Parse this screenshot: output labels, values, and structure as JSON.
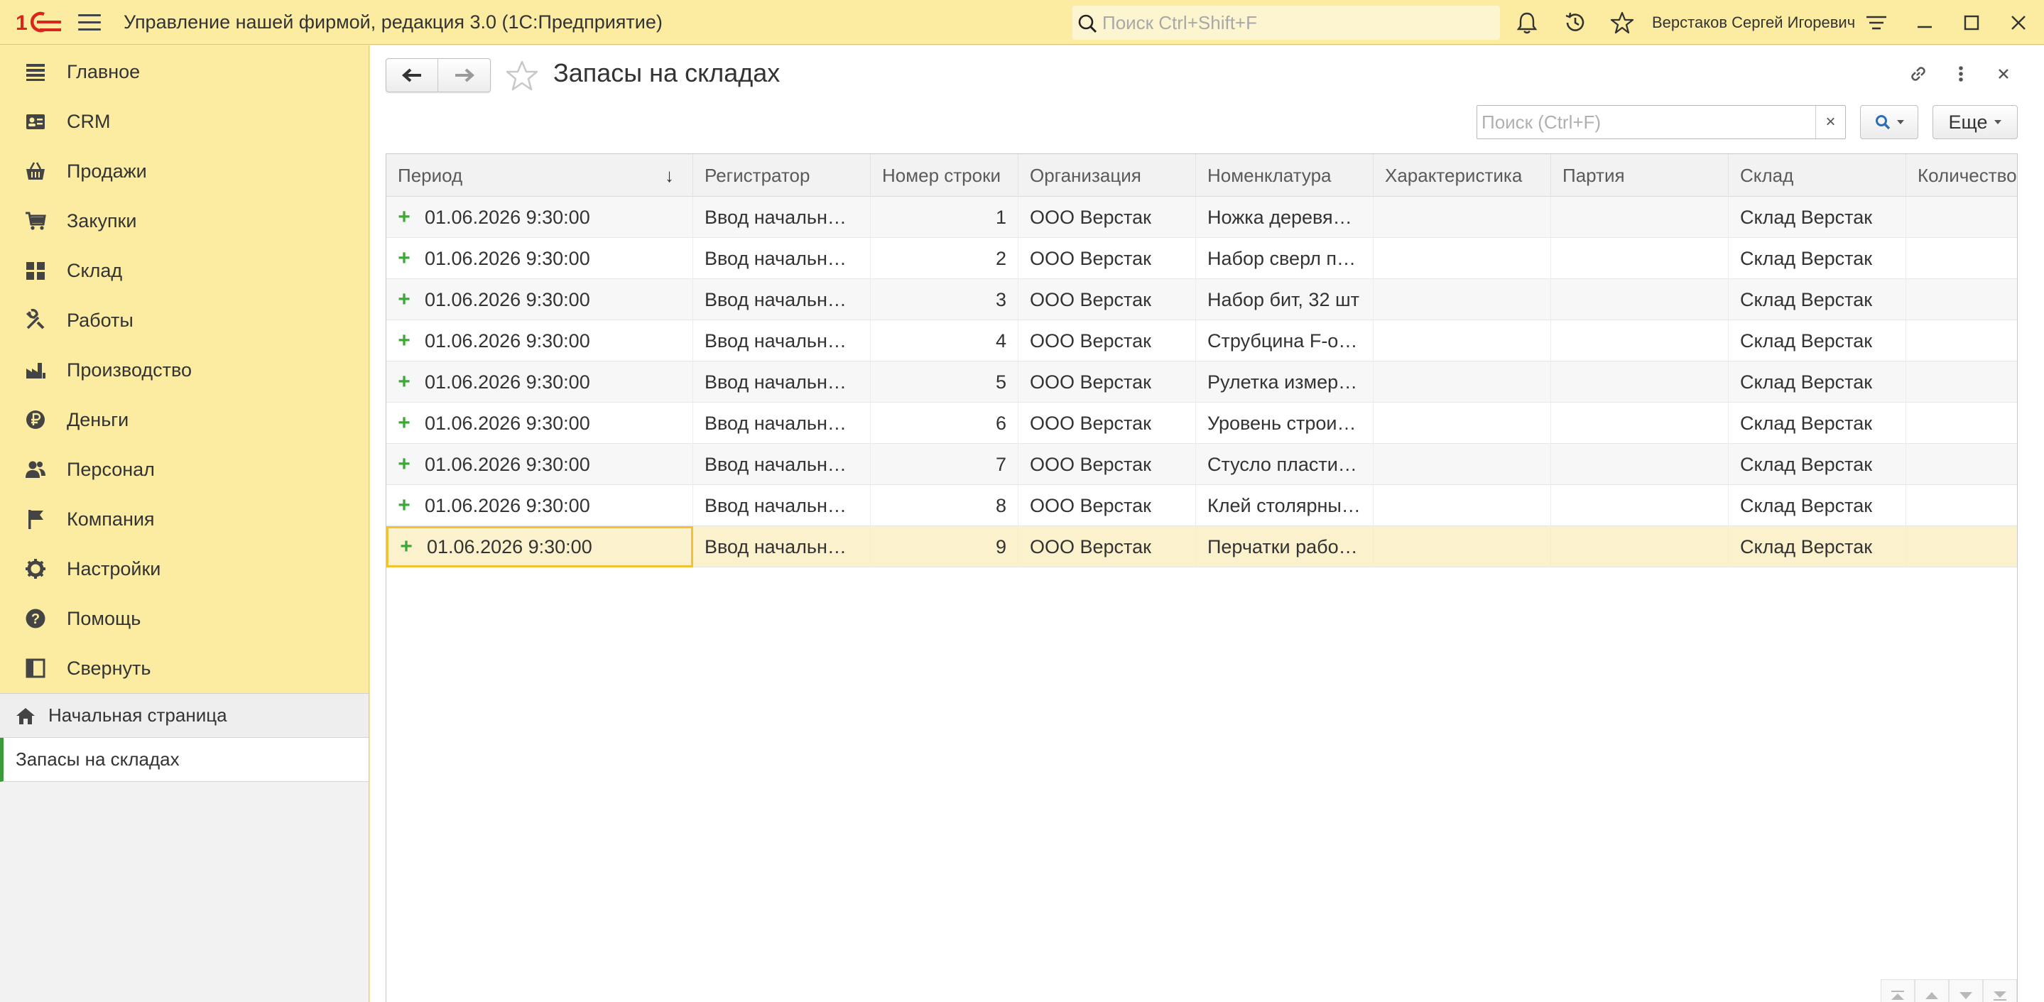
{
  "titlebar": {
    "app_title": "Управление нашей фирмой, редакция 3.0  (1С:Предприятие)",
    "search_placeholder": "Поиск Ctrl+Shift+F",
    "user_name": "Верстаков Сергей Игоревич",
    "logo_text": "1С"
  },
  "sidebar": {
    "items": [
      {
        "label": "Главное",
        "icon": "menu-list-icon"
      },
      {
        "label": "CRM",
        "icon": "contacts-icon"
      },
      {
        "label": "Продажи",
        "icon": "basket-icon"
      },
      {
        "label": "Закупки",
        "icon": "cart-icon"
      },
      {
        "label": "Склад",
        "icon": "warehouse-grid-icon"
      },
      {
        "label": "Работы",
        "icon": "tools-icon"
      },
      {
        "label": "Производство",
        "icon": "factory-icon"
      },
      {
        "label": "Деньги",
        "icon": "ruble-icon"
      },
      {
        "label": "Персонал",
        "icon": "people-icon"
      },
      {
        "label": "Компания",
        "icon": "flag-icon"
      },
      {
        "label": "Настройки",
        "icon": "gear-icon"
      },
      {
        "label": "Помощь",
        "icon": "help-icon"
      },
      {
        "label": "Свернуть",
        "icon": "collapse-panel-icon"
      }
    ],
    "open_windows": {
      "home_label": "Начальная страница",
      "current_label": "Запасы на складах"
    }
  },
  "form": {
    "title": "Запасы на складах",
    "search_placeholder": "Поиск (Ctrl+F)",
    "clear_label": "×",
    "more_label": "Еще"
  },
  "table": {
    "columns": [
      "Период",
      "Регистратор",
      "Номер строки",
      "Организация",
      "Номенклатура",
      "Характеристика",
      "Партия",
      "Склад",
      "Количество"
    ],
    "rows": [
      {
        "period": "01.06.2026 9:30:00",
        "registrar": "Ввод начальн…",
        "line": "1",
        "org": "ООО Верстак",
        "item": "Ножка деревя…",
        "characteristic": "",
        "batch": "",
        "warehouse": "Склад Верстак",
        "qty": ""
      },
      {
        "period": "01.06.2026 9:30:00",
        "registrar": "Ввод начальн…",
        "line": "2",
        "org": "ООО Верстак",
        "item": "Набор сверл п…",
        "characteristic": "",
        "batch": "",
        "warehouse": "Склад Верстак",
        "qty": ""
      },
      {
        "period": "01.06.2026 9:30:00",
        "registrar": "Ввод начальн…",
        "line": "3",
        "org": "ООО Верстак",
        "item": "Набор бит, 32 шт",
        "characteristic": "",
        "batch": "",
        "warehouse": "Склад Верстак",
        "qty": ""
      },
      {
        "period": "01.06.2026 9:30:00",
        "registrar": "Ввод начальн…",
        "line": "4",
        "org": "ООО Верстак",
        "item": "Струбцина F-о…",
        "characteristic": "",
        "batch": "",
        "warehouse": "Склад Верстак",
        "qty": ""
      },
      {
        "period": "01.06.2026 9:30:00",
        "registrar": "Ввод начальн…",
        "line": "5",
        "org": "ООО Верстак",
        "item": "Рулетка измер…",
        "characteristic": "",
        "batch": "",
        "warehouse": "Склад Верстак",
        "qty": ""
      },
      {
        "period": "01.06.2026 9:30:00",
        "registrar": "Ввод начальн…",
        "line": "6",
        "org": "ООО Верстак",
        "item": "Уровень строи…",
        "characteristic": "",
        "batch": "",
        "warehouse": "Склад Верстак",
        "qty": ""
      },
      {
        "period": "01.06.2026 9:30:00",
        "registrar": "Ввод начальн…",
        "line": "7",
        "org": "ООО Верстак",
        "item": "Стусло пласти…",
        "characteristic": "",
        "batch": "",
        "warehouse": "Склад Верстак",
        "qty": ""
      },
      {
        "period": "01.06.2026 9:30:00",
        "registrar": "Ввод начальн…",
        "line": "8",
        "org": "ООО Верстак",
        "item": "Клей столярны…",
        "characteristic": "",
        "batch": "",
        "warehouse": "Склад Верстак",
        "qty": ""
      },
      {
        "period": "01.06.2026 9:30:00",
        "registrar": "Ввод начальн…",
        "line": "9",
        "org": "ООО Верстак",
        "item": "Перчатки рабо…",
        "characteristic": "",
        "batch": "",
        "warehouse": "Склад Верстак",
        "qty": ""
      }
    ],
    "selected_row": 9,
    "sort_indicator": "↓",
    "row_marker": "+"
  },
  "colors": {
    "panel_yellow": "#fbeca2",
    "logo_red": "#d9261c",
    "accent_green": "#3a9b3a",
    "selection_row": "#fbf1cc",
    "focus_border": "#f1c232",
    "plus_green": "#3aaa35"
  }
}
